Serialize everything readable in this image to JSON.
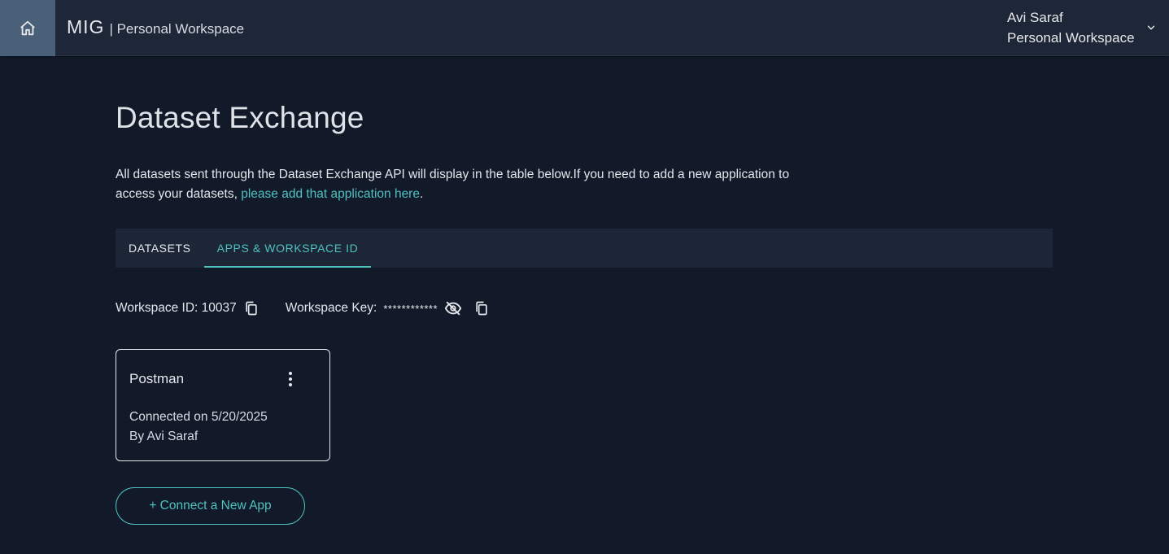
{
  "header": {
    "home_icon": "home-icon",
    "brand_name": "MIG",
    "brand_subtitle": "| Personal Workspace",
    "user_name": "Avi Saraf",
    "user_workspace": "Personal Workspace",
    "dropdown_icon": "chevron-down-icon"
  },
  "page": {
    "title": "Dataset Exchange",
    "description": "All datasets sent through the Dataset Exchange API will display in the table below.If you need to add a new application to access your datasets, ",
    "description_link": "please add that application here",
    "description_end": "."
  },
  "tabs": [
    {
      "label": "DATASETS",
      "active": false
    },
    {
      "label": "APPS & WORKSPACE ID",
      "active": true
    }
  ],
  "workspace": {
    "id_label": "Workspace ID: 10037",
    "key_label": "Workspace Key:",
    "key_value": "************",
    "copy_icon": "copy-icon",
    "visibility_icon": "eye-off-icon"
  },
  "app_card": {
    "name": "Postman",
    "connected": "Connected on 5/20/2025",
    "by": "By Avi Saraf",
    "menu_icon": "more-vertical-icon"
  },
  "connect_button": "+ Connect a New App",
  "colors": {
    "background": "#121a2a",
    "header": "#1e2737",
    "home_button": "#4a6079",
    "accent": "#4fc1c0",
    "tab_bar": "#1d2636"
  }
}
